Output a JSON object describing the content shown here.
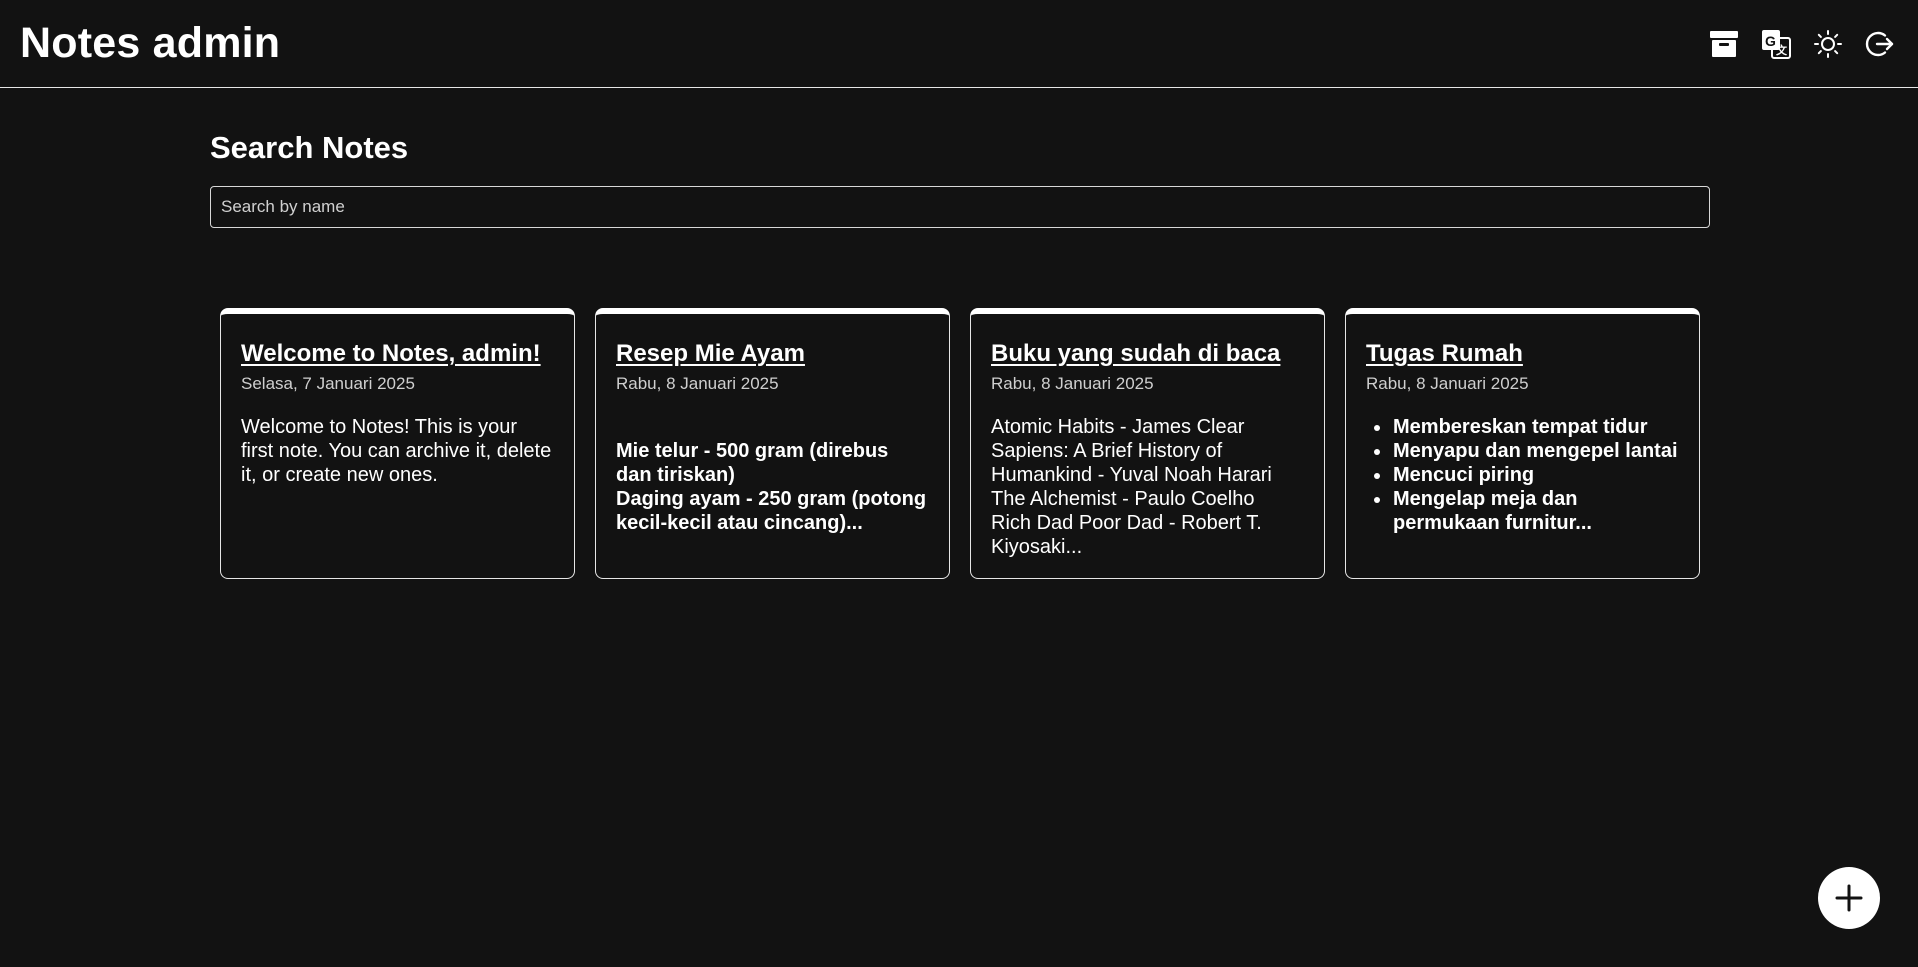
{
  "header": {
    "title": "Notes admin",
    "actions": [
      {
        "name": "archive-icon"
      },
      {
        "name": "translate-icon"
      },
      {
        "name": "sun-icon"
      },
      {
        "name": "logout-icon"
      }
    ]
  },
  "search": {
    "heading": "Search Notes",
    "placeholder": "Search by name",
    "value": ""
  },
  "notes": [
    {
      "title": "Welcome to Notes, admin!",
      "date": "Selasa, 7 Januari 2025",
      "body": "Welcome to Notes! This is your first note. You can archive it, delete it, or create new ones."
    },
    {
      "title": "Resep Mie Ayam",
      "date": "Rabu, 8 Januari 2025",
      "lines": [
        "Mie telur - 500 gram (direbus dan tiriskan)",
        "Daging ayam - 250 gram (potong kecil-kecil atau cincang)..."
      ]
    },
    {
      "title": "Buku yang sudah di baca",
      "date": "Rabu, 8 Januari 2025",
      "lines": [
        "Atomic Habits - James Clear",
        "Sapiens: A Brief History of Humankind - Yuval Noah Harari",
        "The Alchemist - Paulo Coelho",
        "Rich Dad Poor Dad - Robert T. Kiyosaki..."
      ]
    },
    {
      "title": "Tugas Rumah",
      "date": "Rabu, 8 Januari 2025",
      "items": [
        "Membereskan tempat tidur",
        "Menyapu dan mengepel lantai",
        "Mencuci piring",
        "Mengelap meja dan permukaan furnitur..."
      ]
    }
  ],
  "fab": {
    "icon": "plus-icon"
  }
}
